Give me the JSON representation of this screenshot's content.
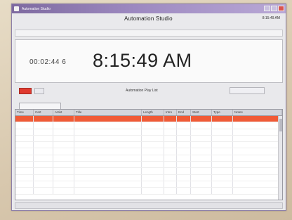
{
  "window": {
    "title": "Automation Studio"
  },
  "toolbar": {
    "studio_title": "Automation Studio",
    "clock_readout": "8:15:49 AM"
  },
  "clock": {
    "counter": "00:02:44 6",
    "big_time": "8:15:49 AM"
  },
  "playlist": {
    "title": "Automation Play List"
  },
  "grid": {
    "columns": [
      "Time",
      "Cart",
      "Artist",
      "Title",
      "Length",
      "Intro",
      "End",
      "Start",
      "Type",
      "Notes"
    ],
    "rows": [
      [
        "",
        "",
        "",
        "",
        "",
        "",
        "",
        "",
        "",
        ""
      ],
      [
        "",
        "",
        "",
        "",
        "",
        "",
        "",
        "",
        "",
        ""
      ],
      [
        "",
        "",
        "",
        "",
        "",
        "",
        "",
        "",
        "",
        ""
      ],
      [
        "",
        "",
        "",
        "",
        "",
        "",
        "",
        "",
        "",
        ""
      ],
      [
        "",
        "",
        "",
        "",
        "",
        "",
        "",
        "",
        "",
        ""
      ],
      [
        "",
        "",
        "",
        "",
        "",
        "",
        "",
        "",
        "",
        ""
      ],
      [
        "",
        "",
        "",
        "",
        "",
        "",
        "",
        "",
        "",
        ""
      ],
      [
        "",
        "",
        "",
        "",
        "",
        "",
        "",
        "",
        "",
        ""
      ],
      [
        "",
        "",
        "",
        "",
        "",
        "",
        "",
        "",
        "",
        ""
      ],
      [
        "",
        "",
        "",
        "",
        "",
        "",
        "",
        "",
        "",
        ""
      ],
      [
        "",
        "",
        "",
        "",
        "",
        "",
        "",
        "",
        "",
        ""
      ],
      [
        "",
        "",
        "",
        "",
        "",
        "",
        "",
        "",
        "",
        ""
      ]
    ],
    "selected_row": 0
  },
  "colors": {
    "title_bar": "#8d7ab3",
    "selected_row": "#f05a36",
    "red_button": "#e03a2f"
  }
}
